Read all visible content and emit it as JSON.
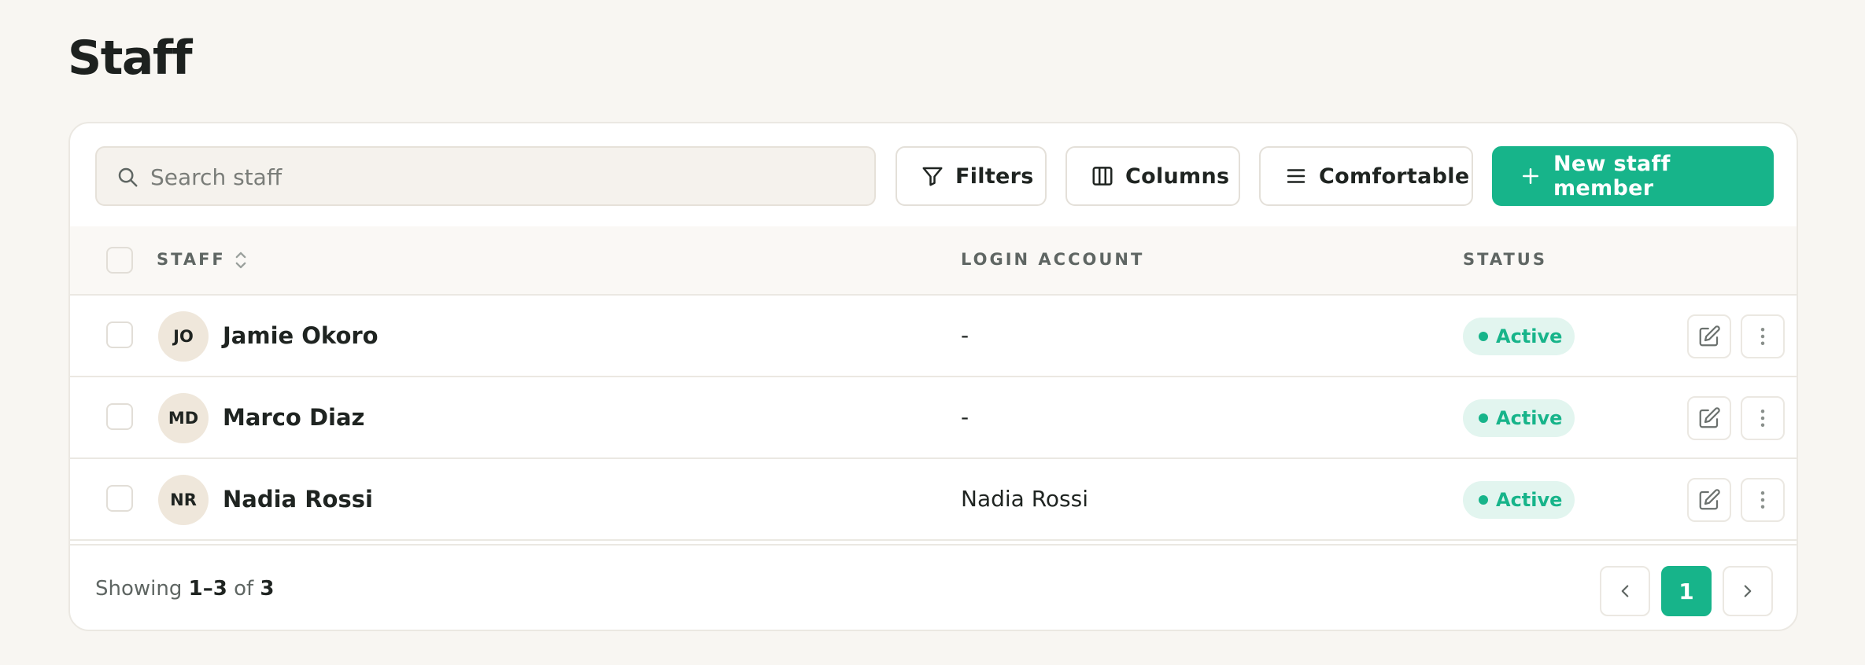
{
  "page": {
    "title": "Staff"
  },
  "toolbar": {
    "search_placeholder": "Search staff",
    "filters_label": "Filters",
    "columns_label": "Columns",
    "density_label": "Comfortable",
    "new_label": "New staff member",
    "accent_color": "#17b48a"
  },
  "table": {
    "columns": [
      "STAFF",
      "LOGIN ACCOUNT",
      "STATUS"
    ],
    "rows": [
      {
        "initials": "JO",
        "name": "Jamie Okoro",
        "login": "-",
        "status": "Active"
      },
      {
        "initials": "MD",
        "name": "Marco Diaz",
        "login": "-",
        "status": "Active"
      },
      {
        "initials": "NR",
        "name": "Nadia Rossi",
        "login": "Nadia Rossi",
        "status": "Active"
      }
    ]
  },
  "footer": {
    "showing_prefix": "Showing",
    "range": "1–3",
    "of_label": "of",
    "total": "3",
    "current_page": "1"
  },
  "icons": {
    "search": "search-icon",
    "filters": "filter-icon",
    "columns": "columns-icon",
    "density": "menu-lines-icon",
    "new": "plus-icon",
    "sort": "sort-icon",
    "edit": "edit-icon",
    "more": "more-vertical-icon",
    "prev": "chevron-left-icon",
    "next": "chevron-right-icon"
  }
}
